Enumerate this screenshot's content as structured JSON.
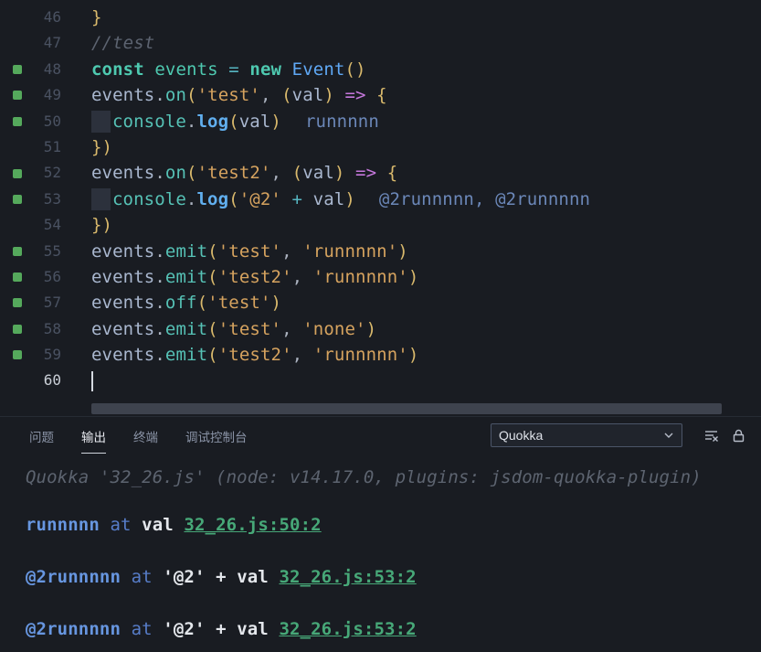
{
  "editor": {
    "cursor_line": 60,
    "lines": [
      {
        "num": 46,
        "covered": false,
        "tokens": [
          {
            "t": "}",
            "c": "brk"
          }
        ]
      },
      {
        "num": 47,
        "covered": false,
        "tokens": [
          {
            "t": "//test",
            "c": "cm"
          }
        ]
      },
      {
        "num": 48,
        "covered": true,
        "tokens": [
          {
            "t": "const ",
            "c": "kw"
          },
          {
            "t": "events ",
            "c": "tv"
          },
          {
            "t": "= ",
            "c": "op"
          },
          {
            "t": "new ",
            "c": "kw"
          },
          {
            "t": "Event",
            "c": "cls"
          },
          {
            "t": "()",
            "c": "brk"
          }
        ]
      },
      {
        "num": 49,
        "covered": true,
        "tokens": [
          {
            "t": "events",
            "c": "var"
          },
          {
            "t": ".",
            "c": "punct"
          },
          {
            "t": "on",
            "c": "fn"
          },
          {
            "t": "(",
            "c": "brk"
          },
          {
            "t": "'test'",
            "c": "str"
          },
          {
            "t": ", ",
            "c": "punct"
          },
          {
            "t": "(",
            "c": "brk"
          },
          {
            "t": "val",
            "c": "var"
          },
          {
            "t": ")",
            "c": "brk"
          },
          {
            "t": " ",
            "c": "plain"
          },
          {
            "t": "=>",
            "c": "arrow"
          },
          {
            "t": " ",
            "c": "plain"
          },
          {
            "t": "{",
            "c": "brk"
          }
        ]
      },
      {
        "num": 50,
        "covered": true,
        "tokens": [
          {
            "c": "tab"
          },
          {
            "t": "console",
            "c": "obj"
          },
          {
            "t": ".",
            "c": "punct"
          },
          {
            "t": "log",
            "c": "log"
          },
          {
            "t": "(",
            "c": "brk"
          },
          {
            "t": "val",
            "c": "var"
          },
          {
            "t": ")",
            "c": "brk"
          }
        ],
        "inline": "runnnnn"
      },
      {
        "num": 51,
        "covered": false,
        "tokens": [
          {
            "t": "})",
            "c": "brk"
          }
        ]
      },
      {
        "num": 52,
        "covered": true,
        "tokens": [
          {
            "t": "events",
            "c": "var"
          },
          {
            "t": ".",
            "c": "punct"
          },
          {
            "t": "on",
            "c": "fn"
          },
          {
            "t": "(",
            "c": "brk"
          },
          {
            "t": "'test2'",
            "c": "str"
          },
          {
            "t": ", ",
            "c": "punct"
          },
          {
            "t": "(",
            "c": "brk"
          },
          {
            "t": "val",
            "c": "var"
          },
          {
            "t": ")",
            "c": "brk"
          },
          {
            "t": " ",
            "c": "plain"
          },
          {
            "t": "=>",
            "c": "arrow"
          },
          {
            "t": " ",
            "c": "plain"
          },
          {
            "t": "{",
            "c": "brk"
          }
        ]
      },
      {
        "num": 53,
        "covered": true,
        "tokens": [
          {
            "c": "tab"
          },
          {
            "t": "console",
            "c": "obj"
          },
          {
            "t": ".",
            "c": "punct"
          },
          {
            "t": "log",
            "c": "log"
          },
          {
            "t": "(",
            "c": "brk"
          },
          {
            "t": "'@2'",
            "c": "str"
          },
          {
            "t": " ",
            "c": "plain"
          },
          {
            "t": "+",
            "c": "op"
          },
          {
            "t": " ",
            "c": "plain"
          },
          {
            "t": "val",
            "c": "var"
          },
          {
            "t": ")",
            "c": "brk"
          }
        ],
        "inline": "@2runnnnn, @2runnnnn"
      },
      {
        "num": 54,
        "covered": false,
        "tokens": [
          {
            "t": "})",
            "c": "brk"
          }
        ]
      },
      {
        "num": 55,
        "covered": true,
        "tokens": [
          {
            "t": "events",
            "c": "var"
          },
          {
            "t": ".",
            "c": "punct"
          },
          {
            "t": "emit",
            "c": "fn"
          },
          {
            "t": "(",
            "c": "brk"
          },
          {
            "t": "'test'",
            "c": "str"
          },
          {
            "t": ", ",
            "c": "punct"
          },
          {
            "t": "'runnnnn'",
            "c": "str"
          },
          {
            "t": ")",
            "c": "brk"
          }
        ]
      },
      {
        "num": 56,
        "covered": true,
        "tokens": [
          {
            "t": "events",
            "c": "var"
          },
          {
            "t": ".",
            "c": "punct"
          },
          {
            "t": "emit",
            "c": "fn"
          },
          {
            "t": "(",
            "c": "brk"
          },
          {
            "t": "'test2'",
            "c": "str"
          },
          {
            "t": ", ",
            "c": "punct"
          },
          {
            "t": "'runnnnn'",
            "c": "str"
          },
          {
            "t": ")",
            "c": "brk"
          }
        ]
      },
      {
        "num": 57,
        "covered": true,
        "tokens": [
          {
            "t": "events",
            "c": "var"
          },
          {
            "t": ".",
            "c": "punct"
          },
          {
            "t": "off",
            "c": "fn"
          },
          {
            "t": "(",
            "c": "brk"
          },
          {
            "t": "'test'",
            "c": "str"
          },
          {
            "t": ")",
            "c": "brk"
          }
        ]
      },
      {
        "num": 58,
        "covered": true,
        "tokens": [
          {
            "t": "events",
            "c": "var"
          },
          {
            "t": ".",
            "c": "punct"
          },
          {
            "t": "emit",
            "c": "fn"
          },
          {
            "t": "(",
            "c": "brk"
          },
          {
            "t": "'test'",
            "c": "str"
          },
          {
            "t": ", ",
            "c": "punct"
          },
          {
            "t": "'none'",
            "c": "str"
          },
          {
            "t": ")",
            "c": "brk"
          }
        ]
      },
      {
        "num": 59,
        "covered": true,
        "tokens": [
          {
            "t": "events",
            "c": "var"
          },
          {
            "t": ".",
            "c": "punct"
          },
          {
            "t": "emit",
            "c": "fn"
          },
          {
            "t": "(",
            "c": "brk"
          },
          {
            "t": "'test2'",
            "c": "str"
          },
          {
            "t": ", ",
            "c": "punct"
          },
          {
            "t": "'runnnnn'",
            "c": "str"
          },
          {
            "t": ")",
            "c": "brk"
          }
        ]
      },
      {
        "num": 60,
        "covered": false,
        "tokens": [],
        "cursor": true
      }
    ]
  },
  "panel": {
    "tabs": [
      {
        "id": "problems",
        "label": "问题",
        "active": false
      },
      {
        "id": "output",
        "label": "输出",
        "active": true
      },
      {
        "id": "terminal",
        "label": "终端",
        "active": false
      },
      {
        "id": "debug-console",
        "label": "调试控制台",
        "active": false
      }
    ],
    "dropdown_value": "Quokka",
    "actions": [
      {
        "icon": "clear-output-icon"
      },
      {
        "icon": "lock-icon"
      }
    ],
    "output": [
      {
        "type": "meta",
        "text": "Quokka '32_26.js' (node: v14.17.0, plugins: jsdom-quokka-plugin)"
      },
      {
        "type": "log",
        "segments": [
          {
            "t": "runnnnn",
            "c": "oval"
          },
          {
            "t": " at ",
            "c": "oat"
          },
          {
            "t": "val ",
            "c": "oexpr"
          },
          {
            "t": "32_26.js:50:2",
            "c": "olink",
            "link": true
          }
        ]
      },
      {
        "type": "log",
        "segments": [
          {
            "t": "@2runnnnn",
            "c": "oval"
          },
          {
            "t": " at ",
            "c": "oat"
          },
          {
            "t": "'@2' + val ",
            "c": "oexpr"
          },
          {
            "t": "32_26.js:53:2",
            "c": "olink",
            "link": true
          }
        ]
      },
      {
        "type": "log",
        "segments": [
          {
            "t": "@2runnnnn",
            "c": "oval"
          },
          {
            "t": " at ",
            "c": "oat"
          },
          {
            "t": "'@2' + val ",
            "c": "oexpr"
          },
          {
            "t": "32_26.js:53:2",
            "c": "olink",
            "link": true
          }
        ]
      }
    ]
  },
  "colors": {
    "background": "#191c22",
    "coverage_green": "#55a95c",
    "string_orange": "#d6a35f",
    "keyword_teal": "#4ec9b0",
    "inline_blue": "#6b87b8",
    "link_green": "#47a878"
  }
}
